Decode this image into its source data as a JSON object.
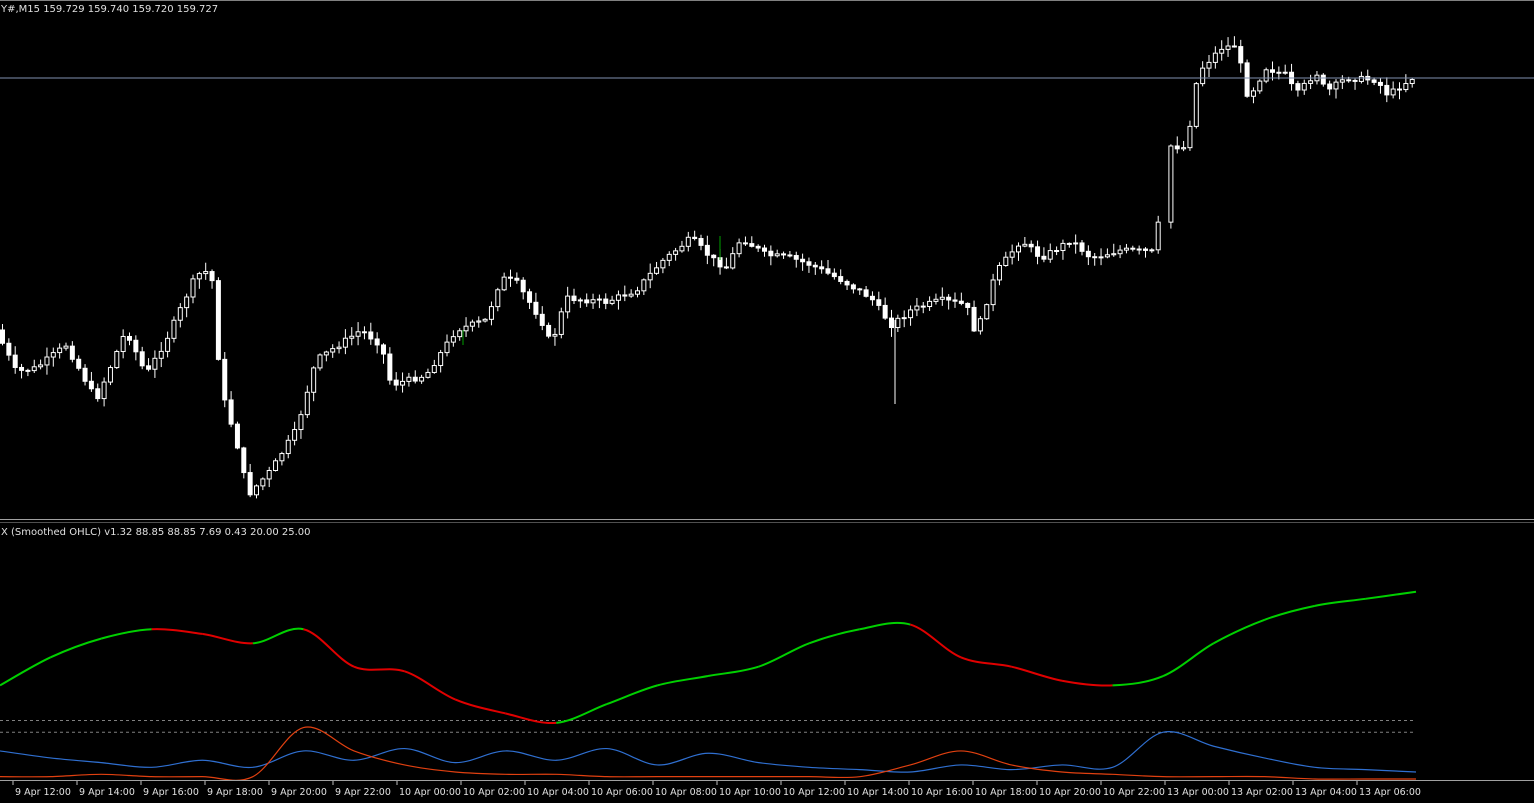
{
  "header": {
    "symbol_line": "Y#,M15  159.729 159.740 159.720 159.727",
    "indicator_line": "X (Smoothed OHLC) v1.32 88.85 88.85 7.69 0.43 20.00 25.00"
  },
  "colors": {
    "background": "#000000",
    "candle": "#ffffff",
    "bull_candle_accent": "#00a000",
    "price_line": "#8090b0",
    "adx_up": "#00d000",
    "adx_down": "#e00000",
    "di_plus": "#2f6fd0",
    "di_minus": "#e04010",
    "level": "#808080"
  },
  "chart_data": [
    {
      "type": "candlestick",
      "symbol_timeframe": "M15",
      "last_ohlc": {
        "open": 159.729,
        "high": 159.74,
        "low": 159.72,
        "close": 159.727
      },
      "current_price_line": 159.727
    },
    {
      "type": "line",
      "indicator": "ADX (Smoothed OHLC)",
      "values_text": "88.85 88.85 7.69 0.43 20.00 25.00",
      "levels": [
        20.0,
        25.0
      ],
      "series": [
        {
          "values": [
            40,
            52,
            60,
            64,
            62,
            58,
            64,
            48,
            46,
            34,
            28,
            24,
            32,
            40,
            44,
            48,
            58,
            64,
            66,
            52,
            48,
            42,
            40,
            44,
            58,
            68,
            74,
            77,
            80
          ]
        },
        {
          "values": [
            12,
            9,
            7,
            5,
            8,
            5,
            12,
            8,
            13,
            7,
            12,
            8,
            13,
            6,
            11,
            7,
            5,
            4,
            3,
            6,
            4,
            6,
            5,
            20,
            14,
            9,
            5,
            4,
            3
          ]
        },
        {
          "values": [
            1,
            1,
            2,
            1,
            1,
            1,
            22,
            12,
            6,
            3,
            2,
            2,
            1,
            1,
            1,
            1,
            1,
            1,
            6,
            12,
            6,
            3,
            2,
            1,
            1,
            1,
            0,
            0,
            0
          ]
        }
      ]
    }
  ],
  "time_axis": {
    "labels": [
      "9 Apr 12:00",
      "9 Apr 14:00",
      "9 Apr 16:00",
      "9 Apr 18:00",
      "9 Apr 20:00",
      "9 Apr 22:00",
      "10 Apr 00:00",
      "10 Apr 02:00",
      "10 Apr 04:00",
      "10 Apr 06:00",
      "10 Apr 08:00",
      "10 Apr 10:00",
      "10 Apr 12:00",
      "10 Apr 14:00",
      "10 Apr 16:00",
      "10 Apr 18:00",
      "10 Apr 20:00",
      "10 Apr 22:00",
      "13 Apr 00:00",
      "13 Apr 02:00",
      "13 Apr 04:00",
      "13 Apr 06:00"
    ]
  }
}
